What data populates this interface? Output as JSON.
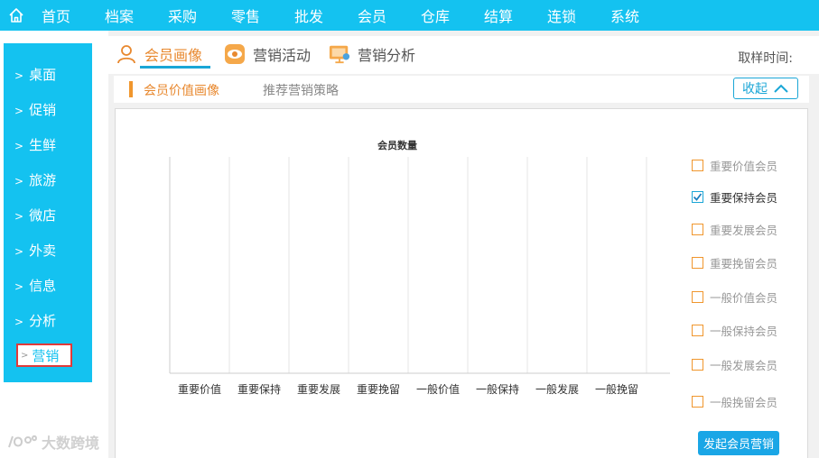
{
  "topnav": {
    "items": [
      "首页",
      "档案",
      "采购",
      "零售",
      "批发",
      "会员",
      "仓库",
      "结算",
      "连锁",
      "系统"
    ]
  },
  "sidebar": {
    "items": [
      "桌面",
      "促销",
      "生鲜",
      "旅游",
      "微店",
      "外卖",
      "信息",
      "分析"
    ],
    "active": "营销",
    "arrow": ">"
  },
  "tabs": {
    "items": [
      {
        "label": "会员画像",
        "icon": "person-icon",
        "active": true
      },
      {
        "label": "营销活动",
        "icon": "eye-icon",
        "active": false
      },
      {
        "label": "营销分析",
        "icon": "monitor-icon",
        "active": false
      }
    ],
    "sample_time_label": "取样时间:"
  },
  "subtabs": {
    "items": [
      {
        "label": "会员价值画像",
        "active": true
      },
      {
        "label": "推荐营销策略",
        "active": false
      }
    ],
    "collapse_label": "收起"
  },
  "colors": {
    "brand": "#14c2f0",
    "accent_orange": "#e8882e",
    "link_blue": "#1aa6d6",
    "highlight_red": "#e03a3a"
  },
  "chart_data": {
    "type": "bar",
    "title": "会员数量",
    "categories": [
      "重要价值",
      "重要保持",
      "重要发展",
      "重要挽留",
      "一般价值",
      "一般保持",
      "一般发展",
      "一般挽留"
    ],
    "series": [],
    "grid": true
  },
  "legend": {
    "items": [
      {
        "label": "重要价值会员",
        "checked": false
      },
      {
        "label": "重要保持会员",
        "checked": true
      },
      {
        "label": "重要发展会员",
        "checked": false
      },
      {
        "label": "重要挽留会员",
        "checked": false
      },
      {
        "label": "一般价值会员",
        "checked": false
      },
      {
        "label": "一般保持会员",
        "checked": false
      },
      {
        "label": "一般发展会员",
        "checked": false
      },
      {
        "label": "一般挽留会员",
        "checked": false
      }
    ]
  },
  "actions": {
    "launch_label": "发起会员营销"
  },
  "watermark": {
    "text": "大数跨境"
  }
}
